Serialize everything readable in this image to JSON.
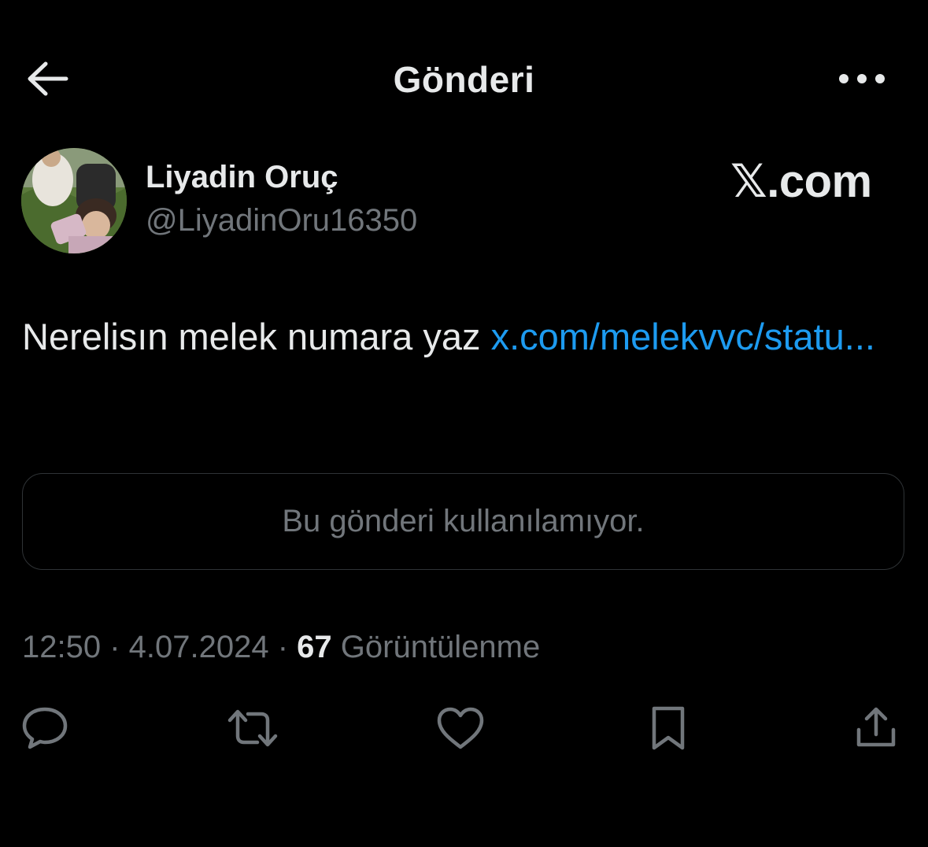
{
  "header": {
    "title": "Gönderi",
    "back_icon": "arrow-left-icon",
    "more_icon": "more-horizontal-icon"
  },
  "author": {
    "name": "Liyadin Oruç",
    "handle": "@LiyadinOru16350"
  },
  "watermark": "𝕏.com",
  "tweet": {
    "text": "Nerelisın melek numara yaz ",
    "link_text": "x.com/melekvvc/statu..."
  },
  "quoted_card": {
    "message": "Bu gönderi kullanılamıyor."
  },
  "meta": {
    "time": "12:50",
    "separator": " · ",
    "date": "4.07.2024",
    "views_count": "67",
    "views_label": " Görüntülenme"
  },
  "actions": [
    {
      "icon": "reply-icon"
    },
    {
      "icon": "retweet-icon"
    },
    {
      "icon": "like-icon"
    },
    {
      "icon": "bookmark-icon"
    },
    {
      "icon": "share-icon"
    }
  ],
  "colors": {
    "background": "#000000",
    "primary_text": "#e7e9ea",
    "secondary_text": "#71767b",
    "link": "#1d9bf0",
    "border": "#2f3336"
  }
}
